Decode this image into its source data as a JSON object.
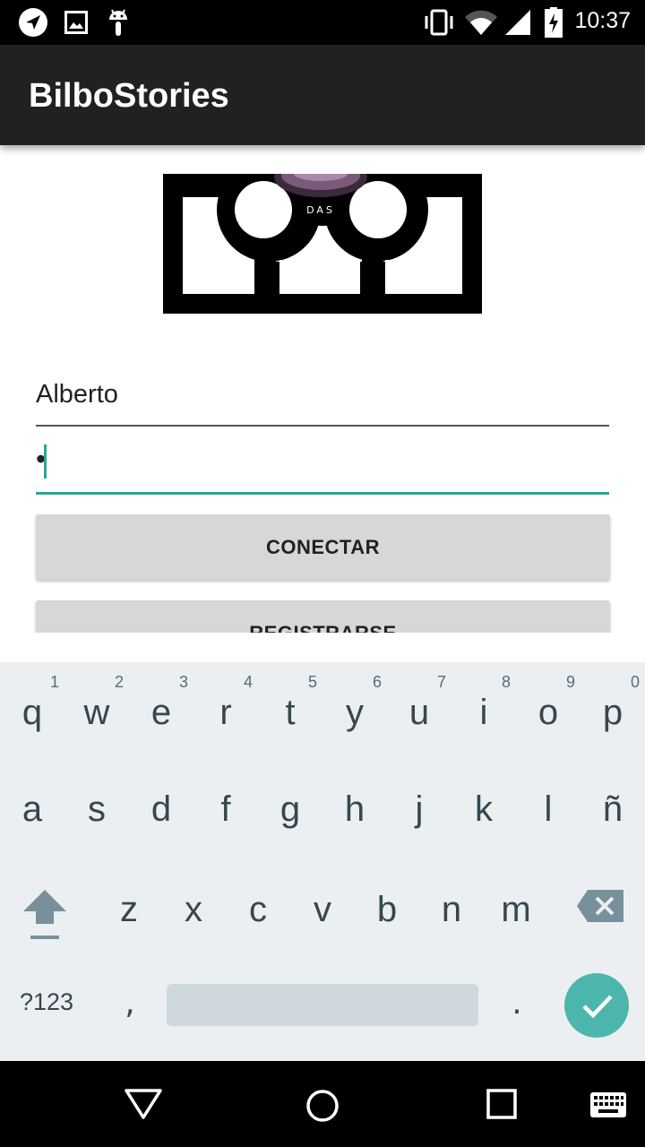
{
  "status_bar": {
    "time": "10:37",
    "icons": [
      "navigation-icon",
      "image-icon",
      "android-icon",
      "vibrate-icon",
      "wifi-icon",
      "signal-icon",
      "battery-charging-icon"
    ]
  },
  "app_bar": {
    "title": "BilboStories"
  },
  "login": {
    "username_value": "Alberto",
    "password_value": "•",
    "connect_label": "CONECTAR",
    "register_label": "REGISTRARSE"
  },
  "logo": {
    "text": "DAS"
  },
  "keyboard": {
    "row1": [
      {
        "key": "q",
        "hint": "1"
      },
      {
        "key": "w",
        "hint": "2"
      },
      {
        "key": "e",
        "hint": "3"
      },
      {
        "key": "r",
        "hint": "4"
      },
      {
        "key": "t",
        "hint": "5"
      },
      {
        "key": "y",
        "hint": "6"
      },
      {
        "key": "u",
        "hint": "7"
      },
      {
        "key": "i",
        "hint": "8"
      },
      {
        "key": "o",
        "hint": "9"
      },
      {
        "key": "p",
        "hint": "0"
      }
    ],
    "row2": [
      "a",
      "s",
      "d",
      "f",
      "g",
      "h",
      "j",
      "k",
      "l",
      "ñ"
    ],
    "row3": [
      "z",
      "x",
      "c",
      "v",
      "b",
      "n",
      "m"
    ],
    "symbols_label": "?123",
    "comma": ",",
    "period": "."
  },
  "colors": {
    "accent": "#26a69a",
    "app_bar": "#212121",
    "button": "#d6d7d7",
    "keyboard_bg": "#eceff1",
    "enter_key": "#4db6ac"
  }
}
